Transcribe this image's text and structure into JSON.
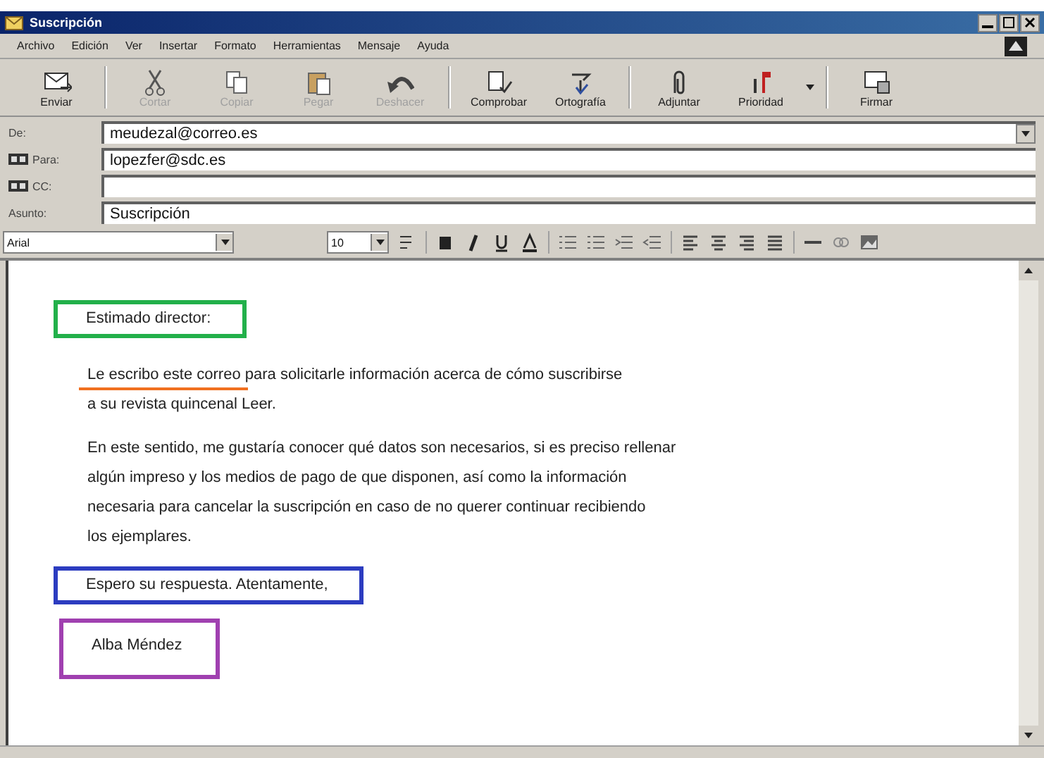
{
  "window": {
    "title": "Suscripción"
  },
  "menu": [
    "Archivo",
    "Edición",
    "Ver",
    "Insertar",
    "Formato",
    "Herramientas",
    "Mensaje",
    "Ayuda"
  ],
  "toolbar": [
    {
      "label": "Enviar",
      "kind": "send",
      "disabled": false
    },
    {
      "label": "Cortar",
      "kind": "cut",
      "disabled": true
    },
    {
      "label": "Copiar",
      "kind": "copy",
      "disabled": true
    },
    {
      "label": "Pegar",
      "kind": "paste",
      "disabled": true
    },
    {
      "label": "Deshacer",
      "kind": "undo",
      "disabled": true
    },
    {
      "label": "Comprobar",
      "kind": "check",
      "disabled": false
    },
    {
      "label": "Ortografía",
      "kind": "spell",
      "disabled": false
    },
    {
      "label": "Adjuntar",
      "kind": "attach",
      "disabled": false
    },
    {
      "label": "Prioridad",
      "kind": "priority",
      "disabled": false
    },
    {
      "label": "Firmar",
      "kind": "sign",
      "disabled": false
    }
  ],
  "fields": [
    {
      "label": "De:",
      "value": "meudezal@correo.es",
      "kind": "dropdown"
    },
    {
      "label": "Para:",
      "value": "lopezfer@sdc.es",
      "kind": "book"
    },
    {
      "label": "CC:",
      "kind": "book"
    },
    {
      "label": "Asunto:",
      "value": "Suscripción",
      "kind": "plain"
    }
  ],
  "format_bar": {
    "font": "Arial",
    "size": "10"
  },
  "body": [
    {
      "text": "Estimado director:",
      "kind": "box",
      "color": "#22b04a"
    },
    {
      "text": "Le escribo este correo para solicitarle información acerca de cómo suscribirse\na su revista quincenal Leer.",
      "kind": "underline",
      "color": "#f07020"
    },
    {
      "text": "En este sentido, me gustaría conocer qué datos son necesarios, si es preciso rellenar\nalgún impreso y los medios de pago de que disponen, así como la información\nnecesaria para cancelar la suscripción en caso de no querer continuar recibiendo\nlos ejemplares.",
      "kind": "plain"
    },
    {
      "text": "Espero su respuesta. Atentamente,",
      "kind": "box",
      "color": "#2c3cc0"
    },
    {
      "text": "Alba Méndez",
      "kind": "box",
      "color": "#a040b0"
    }
  ]
}
